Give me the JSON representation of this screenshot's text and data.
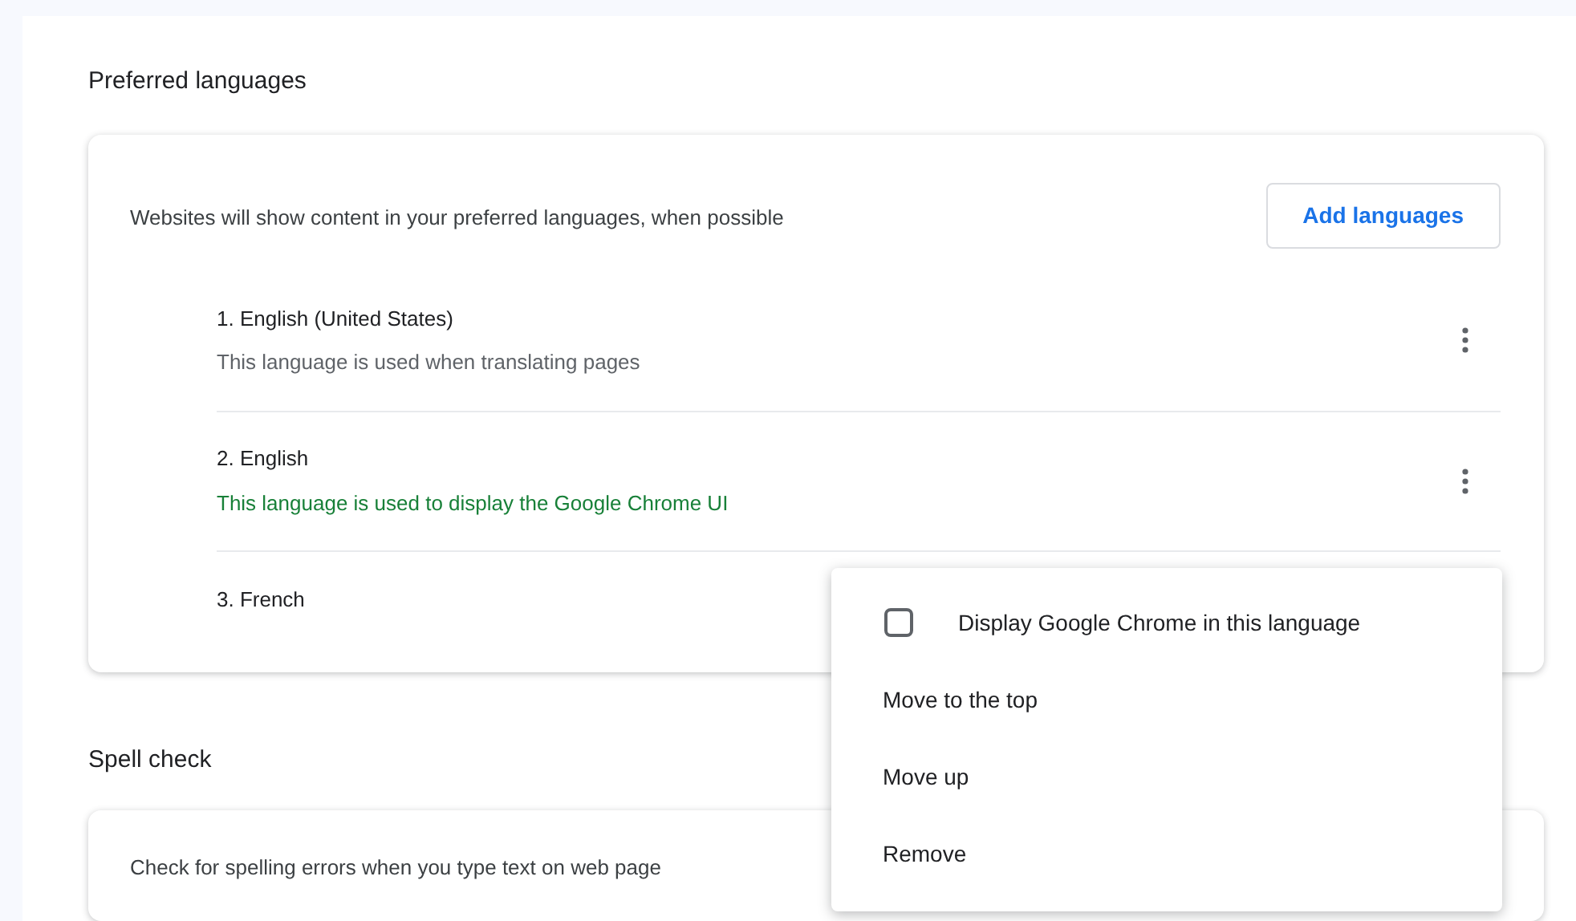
{
  "preferred_languages": {
    "title": "Preferred languages",
    "description": "Websites will show content in your preferred languages, when possible",
    "add_button": "Add languages",
    "languages": [
      {
        "name": "1. English (United States)",
        "note": "This language is used when translating pages",
        "kind": "translate"
      },
      {
        "name": "2. English",
        "note": "This language is used to display the Google Chrome UI",
        "kind": "ui"
      },
      {
        "name": "3. French"
      }
    ]
  },
  "spell_check": {
    "title": "Spell check",
    "description": "Check for spelling errors when you type text on web page"
  },
  "context_menu": {
    "items": [
      {
        "kind": "checkbox",
        "label": "Display Google Chrome in this language",
        "checked": false
      },
      {
        "kind": "action",
        "label": "Move to the top"
      },
      {
        "kind": "action",
        "label": "Move up"
      },
      {
        "kind": "action",
        "label": "Remove"
      }
    ]
  }
}
